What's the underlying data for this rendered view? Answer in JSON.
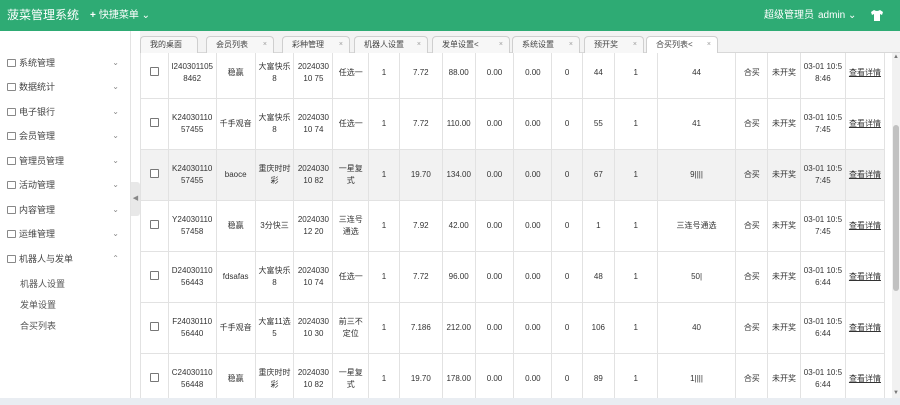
{
  "header": {
    "brand": "菠菜管理系统",
    "quick_menu": "快捷菜单",
    "role": "超级管理员",
    "user": "admin",
    "accent_color": "#2eab74"
  },
  "sidebar": {
    "items": [
      {
        "label": "系统管理",
        "icon": "gear-icon"
      },
      {
        "label": "数据统计",
        "icon": "chart-icon"
      },
      {
        "label": "电子银行",
        "icon": "bank-icon"
      },
      {
        "label": "会员管理",
        "icon": "user-icon"
      },
      {
        "label": "管理员管理",
        "icon": "admin-icon"
      },
      {
        "label": "活动管理",
        "icon": "gift-icon"
      },
      {
        "label": "内容管理",
        "icon": "doc-icon"
      },
      {
        "label": "运维管理",
        "icon": "tool-icon"
      },
      {
        "label": "机器人与发单",
        "icon": "robot-icon"
      }
    ],
    "sub_items": [
      "机器人设置",
      "发单设置",
      "合买列表"
    ]
  },
  "tabs": [
    {
      "label": "我的桌面"
    },
    {
      "label": "会员列表"
    },
    {
      "label": "彩种管理"
    },
    {
      "label": "机器人设置"
    },
    {
      "label": "发单设置<"
    },
    {
      "label": "系统设置"
    },
    {
      "label": "预开奖"
    },
    {
      "label": "合买列表<"
    }
  ],
  "table": {
    "rows": [
      [
        "I2403011058462",
        "稳赢",
        "大富快乐8",
        "202403010 75",
        "任选一",
        "1",
        "7.72",
        "88.00",
        "0.00",
        "0.00",
        "0",
        "44",
        "1",
        "44",
        "合买",
        "未开奖",
        "03-01 10:58:46",
        "查看详情"
      ],
      [
        "K2403011057455",
        "千手观音",
        "大富快乐8",
        "202403010 74",
        "任选一",
        "1",
        "7.72",
        "110.00",
        "0.00",
        "0.00",
        "0",
        "55",
        "1",
        "41",
        "合买",
        "未开奖",
        "03-01 10:57:45",
        "查看详情"
      ],
      [
        "K2403011057455",
        "baoce",
        "重庆时时彩",
        "202403010 82",
        "一星复式",
        "1",
        "19.70",
        "134.00",
        "0.00",
        "0.00",
        "0",
        "67",
        "1",
        "9||||",
        "合买",
        "未开奖",
        "03-01 10:57:45",
        "查看详情"
      ],
      [
        "Y2403011057458",
        "稳赢",
        "3分快三",
        "202403012 20",
        "三连号通选",
        "1",
        "7.92",
        "42.00",
        "0.00",
        "0.00",
        "0",
        "1",
        "1",
        "三连号通选",
        "合买",
        "未开奖",
        "03-01 10:57:45",
        "查看详情"
      ],
      [
        "D2403011056443",
        "fdsafas",
        "大富快乐8",
        "202403010 74",
        "任选一",
        "1",
        "7.72",
        "96.00",
        "0.00",
        "0.00",
        "0",
        "48",
        "1",
        "50|",
        "合买",
        "未开奖",
        "03-01 10:56:44",
        "查看详情"
      ],
      [
        "F2403011056440",
        "千手观音",
        "大富11选5",
        "202403010 30",
        "前三不定位",
        "1",
        "7.186",
        "212.00",
        "0.00",
        "0.00",
        "0",
        "106",
        "1",
        "40",
        "合买",
        "未开奖",
        "03-01 10:56:44",
        "查看详情"
      ],
      [
        "C2403011056448",
        "稳赢",
        "重庆时时彩",
        "202403010 82",
        "一星复式",
        "1",
        "19.70",
        "178.00",
        "0.00",
        "0.00",
        "0",
        "89",
        "1",
        "1||||",
        "合买",
        "未开奖",
        "03-01 10:56:44",
        "查看详情"
      ]
    ]
  }
}
